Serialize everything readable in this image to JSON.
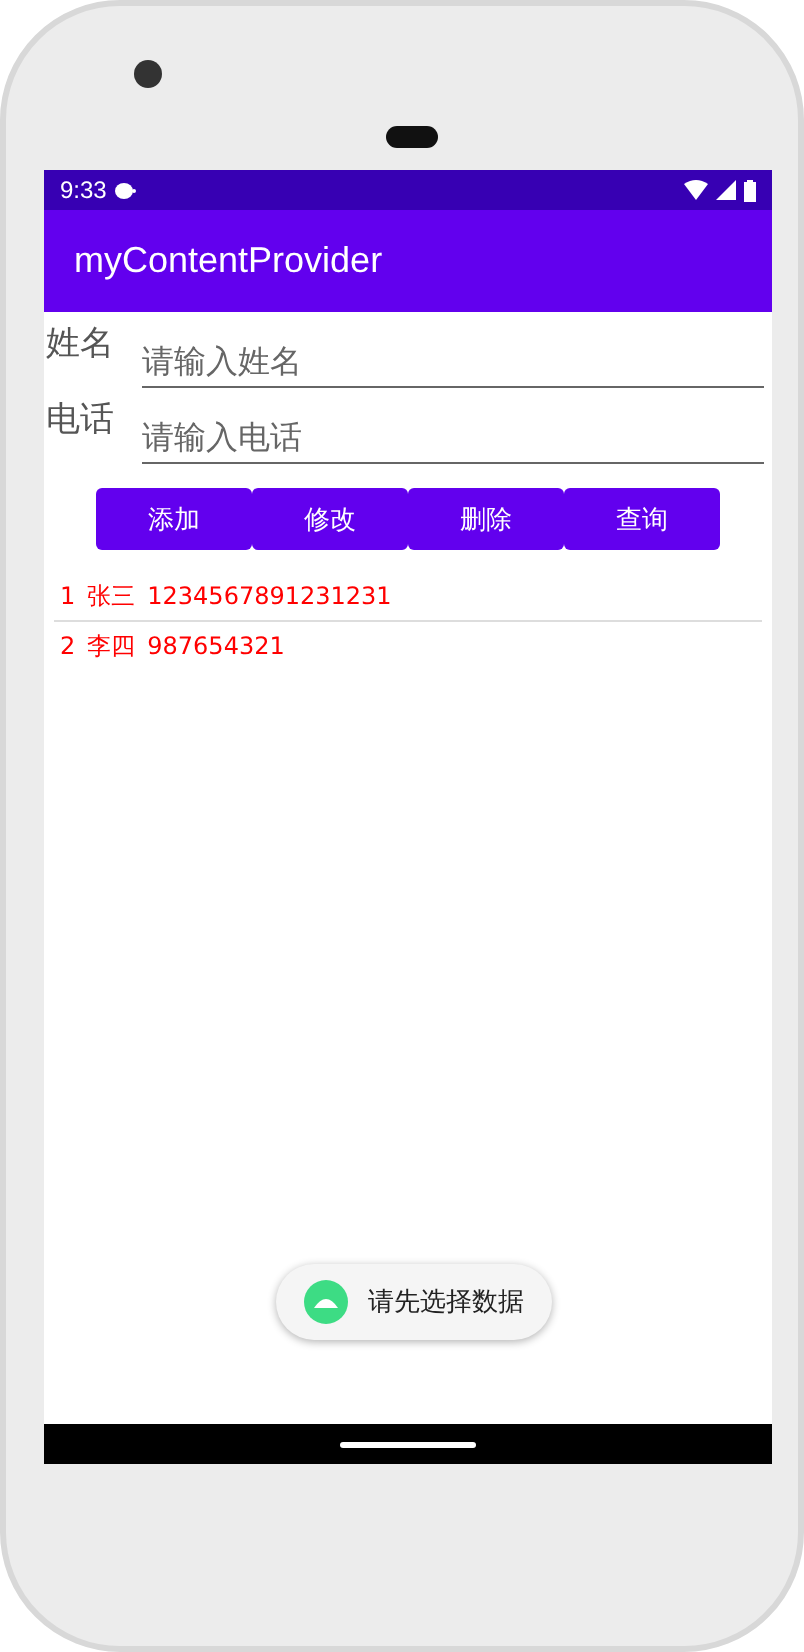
{
  "status_bar": {
    "time": "9:33"
  },
  "app_bar": {
    "title": "myContentProvider"
  },
  "form": {
    "fields": [
      {
        "label": "姓名",
        "placeholder": "请输入姓名"
      },
      {
        "label": "电话",
        "placeholder": "请输入电话"
      }
    ]
  },
  "buttons": [
    "添加",
    "修改",
    "删除",
    "查询"
  ],
  "rows": [
    {
      "id": "1",
      "name": "张三",
      "phone": "1234567891231231"
    },
    {
      "id": "2",
      "name": "李四",
      "phone": "987654321"
    }
  ],
  "toast": {
    "text": "请先选择数据"
  }
}
